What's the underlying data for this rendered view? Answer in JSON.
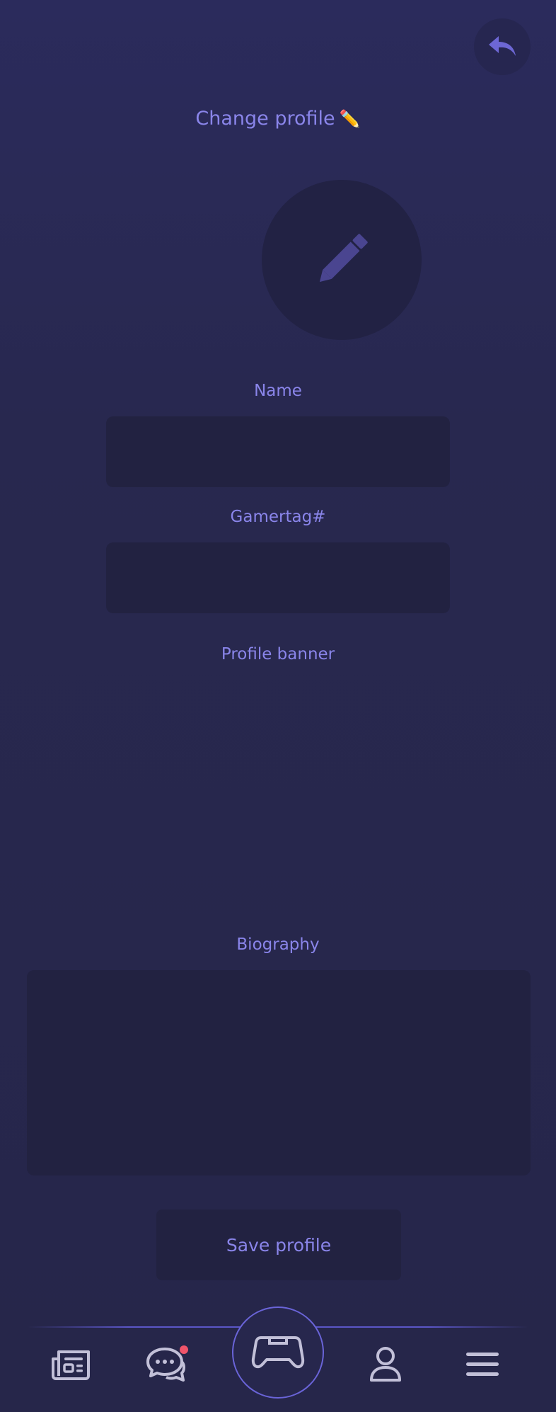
{
  "header": {
    "title": "Change profile",
    "title_emoji": "✏️",
    "back_icon": "reply-arrow-icon"
  },
  "avatar": {
    "icon": "pencil-icon"
  },
  "form": {
    "name_label": "Name",
    "name_value": "",
    "gamertag_label": "Gamertag#",
    "gamertag_value": "",
    "banner_label": "Profile banner",
    "bio_label": "Biography",
    "bio_value": ""
  },
  "actions": {
    "save_label": "Save profile"
  },
  "bottom_nav": {
    "items": [
      {
        "icon": "newspaper-icon"
      },
      {
        "icon": "chat-bubbles-icon",
        "has_notification": true
      },
      {
        "icon": "gamepad-icon"
      },
      {
        "icon": "user-icon"
      },
      {
        "icon": "menu-icon"
      }
    ]
  },
  "colors": {
    "accent": "#8a85ea",
    "background": "#28284f",
    "field": "#222241",
    "notification": "#f0546a"
  }
}
